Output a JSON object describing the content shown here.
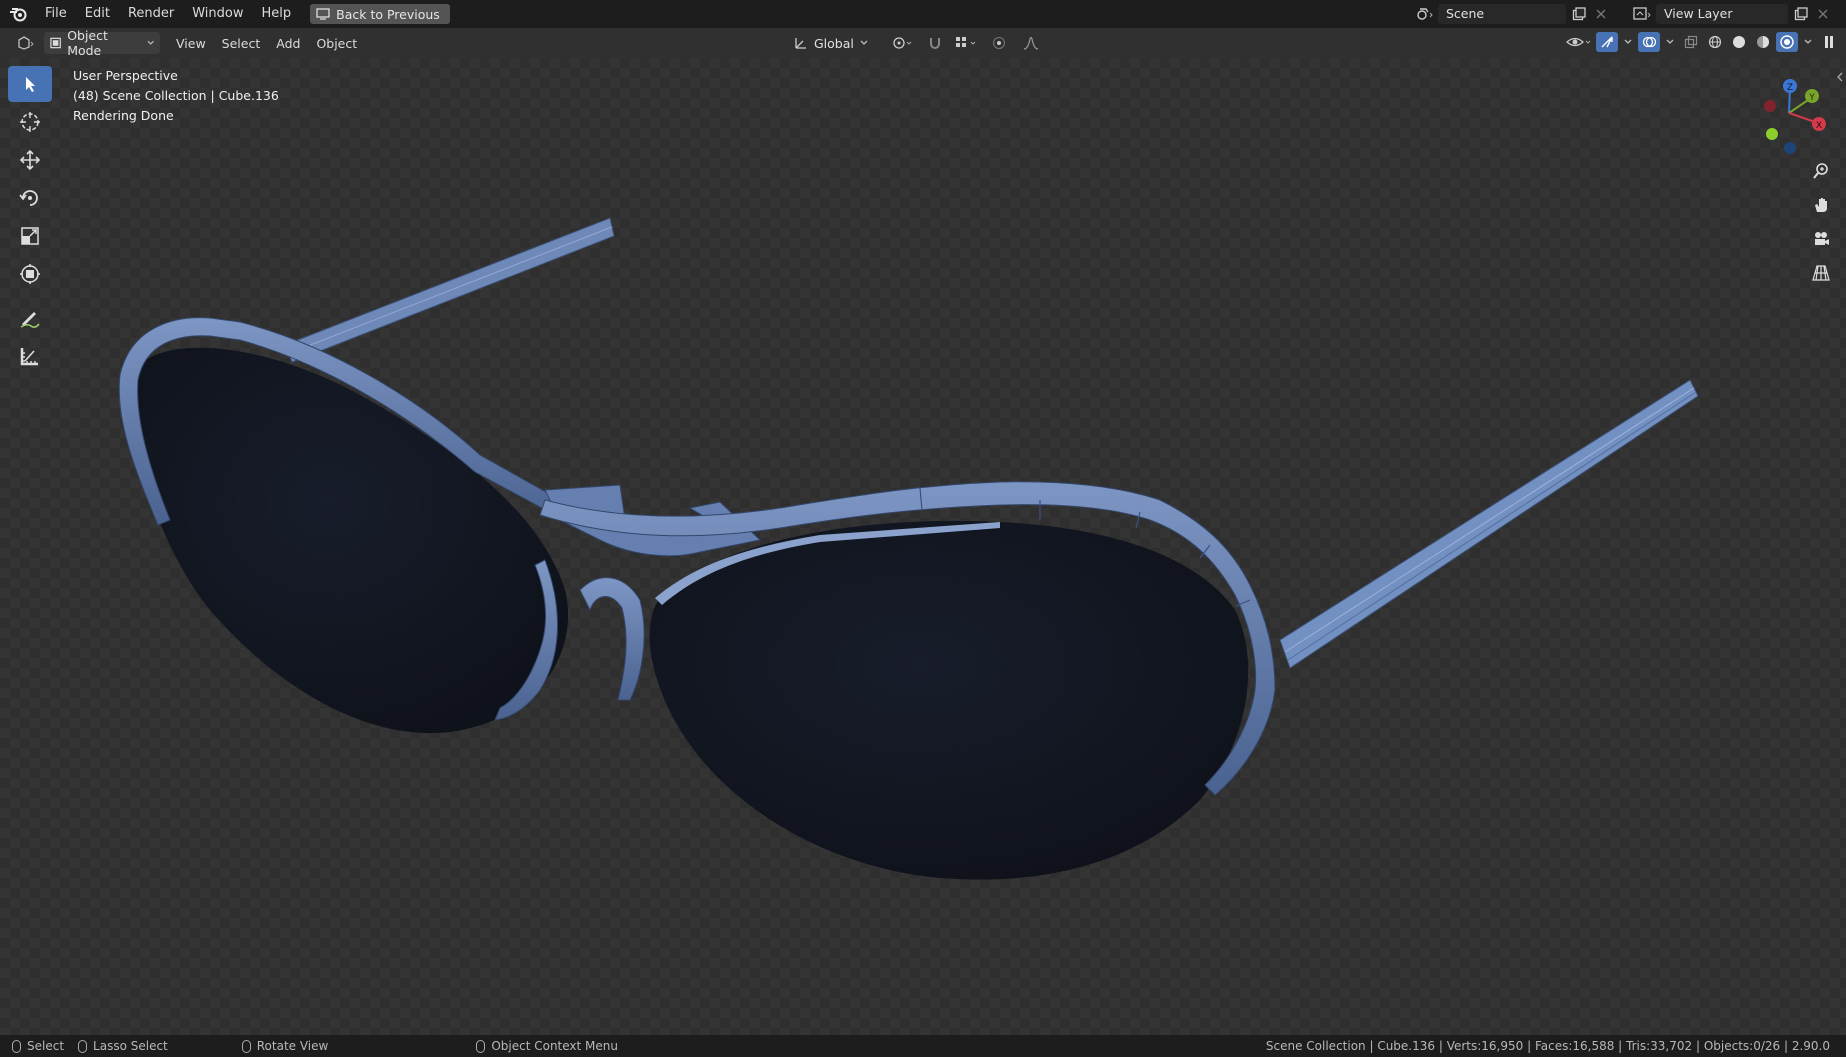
{
  "menubar": {
    "items": [
      "File",
      "Edit",
      "Render",
      "Window",
      "Help"
    ],
    "back_label": "Back to Previous",
    "scene_value": "Scene",
    "view_layer_value": "View Layer"
  },
  "header": {
    "mode": "Object Mode",
    "menus": [
      "View",
      "Select",
      "Add",
      "Object"
    ],
    "transform_orientation": "Global"
  },
  "viewport": {
    "info_lines": [
      "User Perspective",
      "(48) Scene Collection | Cube.136",
      "Rendering Done"
    ],
    "gizmo_axes": [
      "Z",
      "Y",
      "X"
    ]
  },
  "toolbar": {
    "tools": [
      "select-box-icon",
      "cursor-icon",
      "move-icon",
      "rotate-icon",
      "scale-icon",
      "transform-icon",
      "annotate-icon",
      "measure-icon"
    ]
  },
  "navigation": {
    "tools": [
      "zoom-icon",
      "hand-pan-icon",
      "camera-view-icon",
      "perspective-toggle-icon"
    ]
  },
  "statusbar": {
    "select": "Select",
    "lasso": "Lasso Select",
    "rotate": "Rotate View",
    "context": "Object Context Menu",
    "stats": "Scene Collection | Cube.136 | Verts:16,950 | Faces:16,588 | Tris:33,702 | Objects:0/26 | 2.90.0"
  },
  "colors": {
    "accent": "#4772b3",
    "frame": "#5d79a8",
    "lens": "#131722"
  }
}
